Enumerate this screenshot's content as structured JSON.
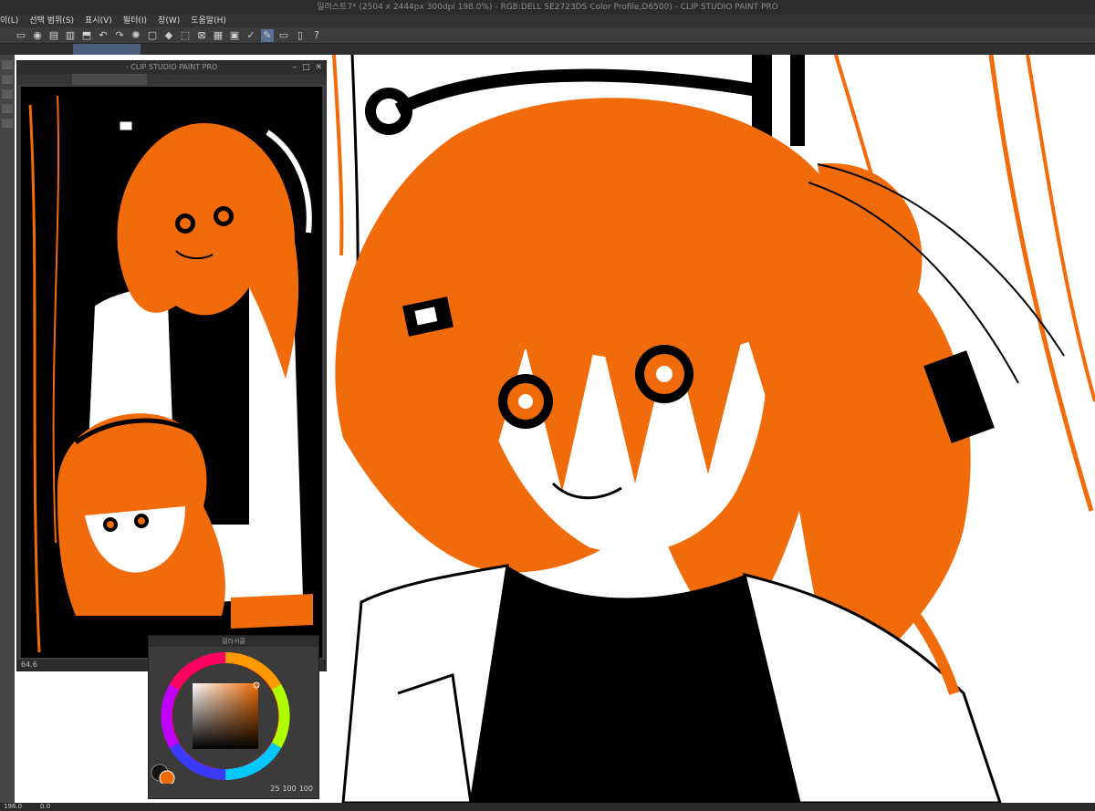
{
  "app": {
    "title": "일러스트7* (2504 x 2444px 300dpi 198.0%) - RGB:DELL SE2723DS Color Profile,D6500) - CLIP STUDIO PAINT PRO"
  },
  "menu": {
    "items": [
      "이(L)",
      "선택 범위(S)",
      "표시(V)",
      "필터(I)",
      "창(W)",
      "도움말(H)"
    ]
  },
  "subwindow": {
    "title": "- CLIP STUDIO PAINT PRO",
    "zoom": "64.6"
  },
  "color_panel": {
    "title": "컬러서클",
    "h": "25",
    "s": "100",
    "v": "100",
    "main_color": "#ef6a00"
  },
  "statusbar": {
    "zoom": "198.0",
    "angle": "0.0"
  },
  "colors": {
    "orange": "#f26b0a",
    "black": "#000000"
  }
}
